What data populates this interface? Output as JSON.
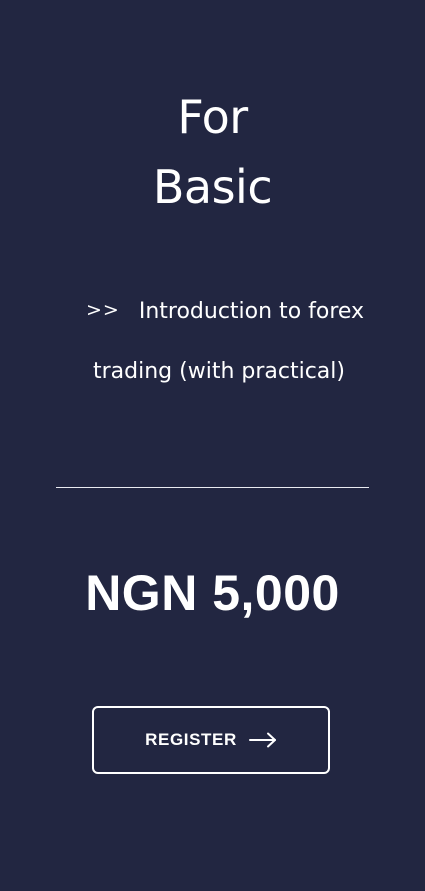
{
  "card": {
    "title_line1": "For",
    "title_line2": "Basic",
    "feature_marker": ">>",
    "feature_line1": "Introduction to forex",
    "feature_line2": "trading (with practical)",
    "price": "NGN 5,000",
    "register_label": "REGISTER",
    "register_icon": "arrow-right-icon"
  },
  "colors": {
    "background": "#222641",
    "text": "#ffffff",
    "divider": "#e9eaf0"
  }
}
